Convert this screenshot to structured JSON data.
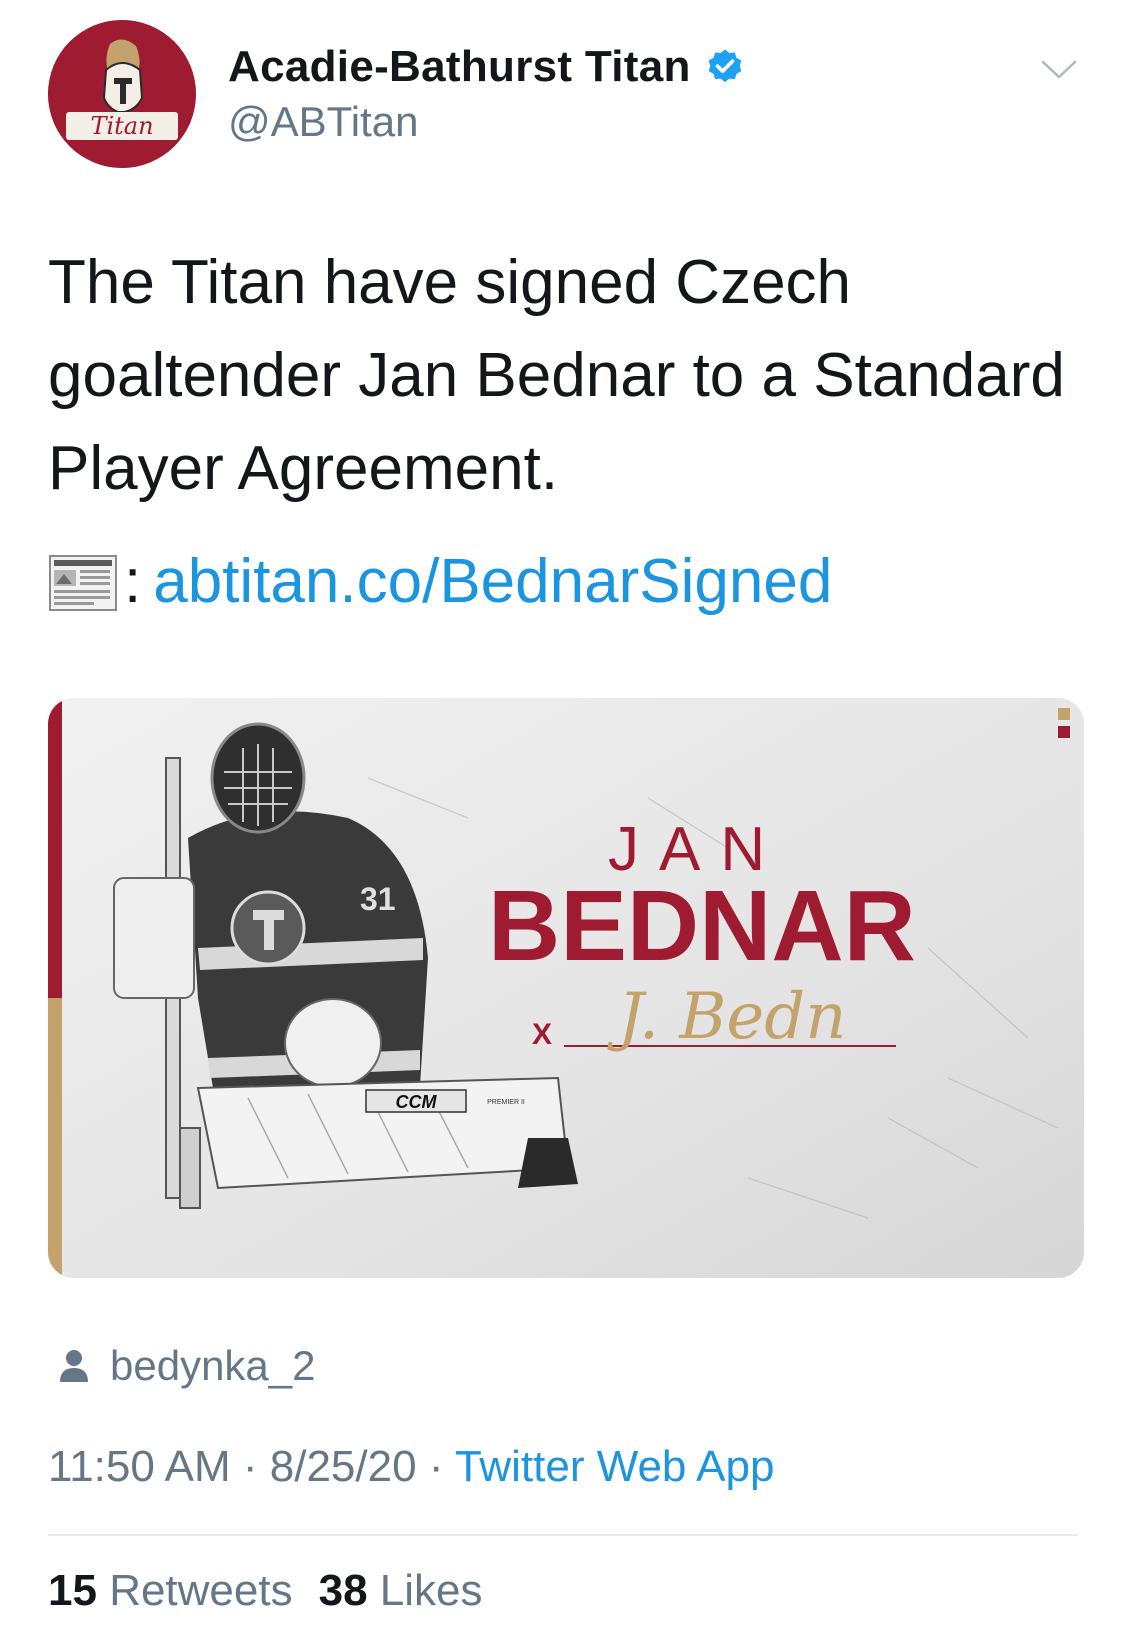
{
  "tweet": {
    "author": {
      "display_name": "Acadie-Bathurst Titan",
      "handle": "@ABTitan",
      "verified": true,
      "avatar_wordmark": "Titan",
      "avatar_color": "#9e1b32"
    },
    "text": "The Titan have signed Czech goaltender Jan Bednar to a Standard Player Agreement.",
    "link_prefix_icon": "newspaper-icon",
    "link_separator": ":",
    "link_text": "abtitan.co/BednarSigned",
    "media": {
      "first_name": "JAN",
      "last_name": "BEDNAR",
      "signature_mark": "X",
      "signature_text": "J. Bedn",
      "jersey_number": "31",
      "equipment_brand": "CCM",
      "pad_model": "PREMIER II",
      "primary_color": "#9e1b32",
      "accent_color": "#c4a26b"
    },
    "tagged_user": "bedynka_2",
    "time": "11:50 AM",
    "date": "8/25/20",
    "separator": "·",
    "source": "Twitter Web App",
    "stats": {
      "retweets_count": "15",
      "retweets_label": "Retweets",
      "likes_count": "38",
      "likes_label": "Likes"
    }
  }
}
